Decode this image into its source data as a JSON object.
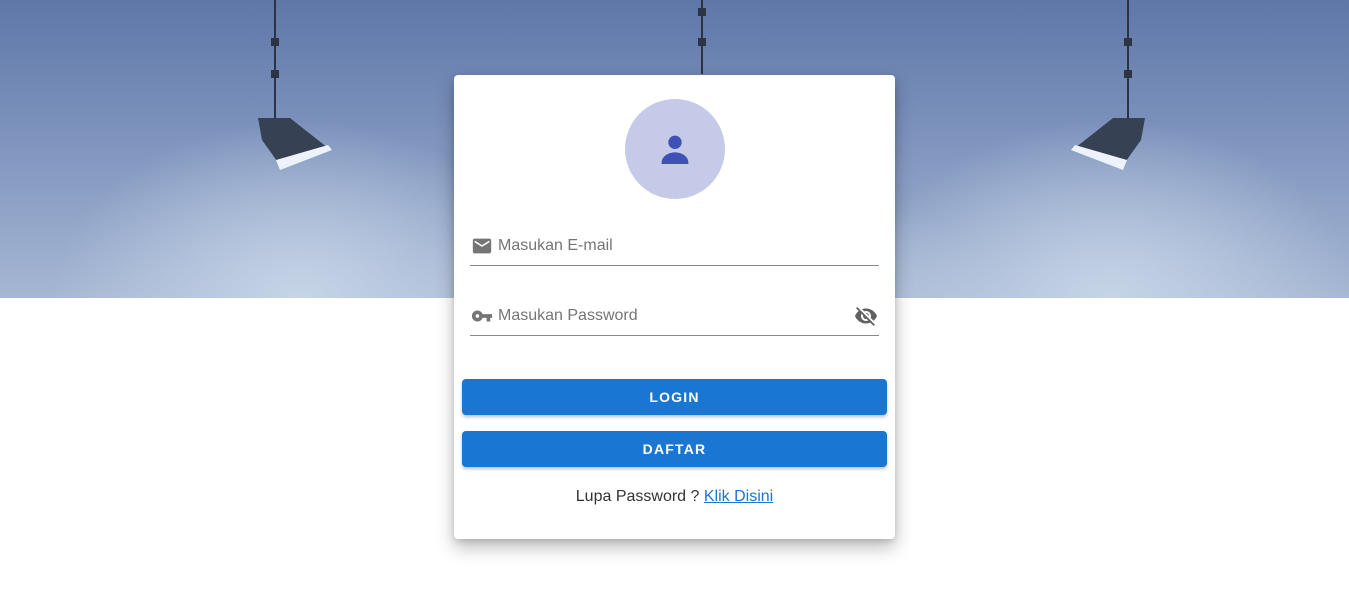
{
  "background": {
    "image_description": "studio-lamps"
  },
  "login_card": {
    "avatar_icon": "person-icon",
    "email": {
      "icon": "mail-icon",
      "placeholder": "Masukan E-mail",
      "value": ""
    },
    "password": {
      "icon": "key-icon",
      "placeholder": "Masukan Password",
      "value": "",
      "toggle_icon": "eye-off-icon"
    },
    "login_label": "LOGIN",
    "register_label": "DAFTAR",
    "forgot_text": "Lupa Password ?",
    "forgot_link": "Klik Disini"
  },
  "colors": {
    "primary": "#1976d2",
    "avatar_bg": "#c5cae9",
    "avatar_icon": "#3f51b5"
  }
}
